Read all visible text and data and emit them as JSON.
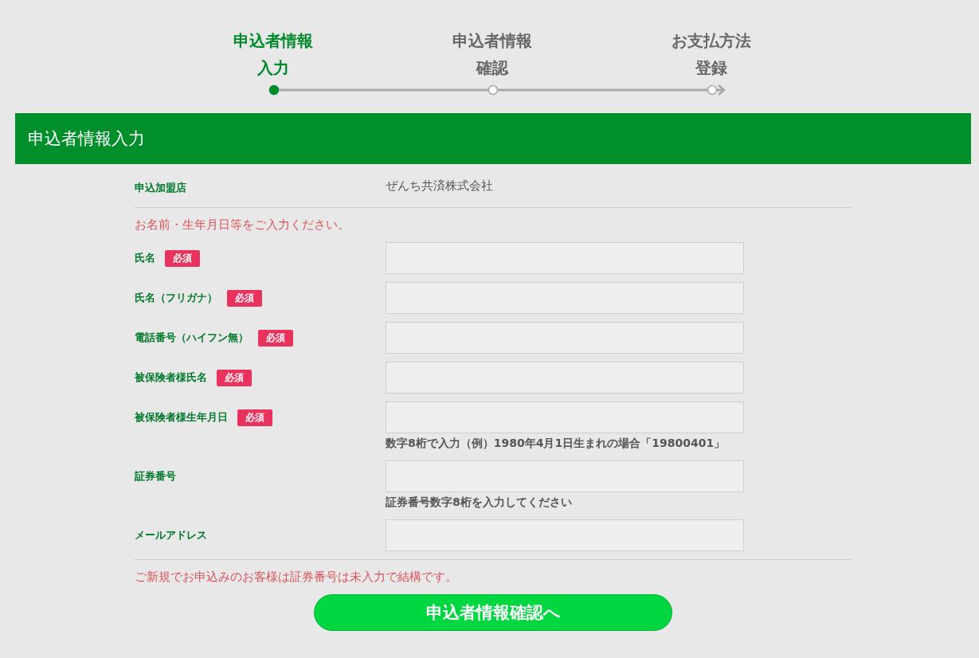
{
  "steps": [
    {
      "line1": "申込者情報",
      "line2": "入力",
      "selected": true
    },
    {
      "line1": "申込者情報",
      "line2": "確認",
      "selected": false
    },
    {
      "line1": "お支払方法",
      "line2": "登録",
      "selected": false
    }
  ],
  "section_title": "申込者情報入力",
  "shop": {
    "label": "申込加盟店",
    "value": "ぜんち共済株式会社"
  },
  "intro_notice": "お名前・生年月日等をご入力ください。",
  "fields": [
    {
      "label": "氏名",
      "badge": "必須"
    },
    {
      "label": "氏名（フリガナ）",
      "badge": "必須"
    },
    {
      "label": "電話番号（ハイフン無）",
      "badge": "必須"
    },
    {
      "label": "被保険者様氏名",
      "badge": "必須"
    },
    {
      "label": "被保険者様生年月日",
      "badge": "必須",
      "hint": "数字8桁で入力（例）1980年4月1日生まれの場合「19800401」"
    },
    {
      "label": "証券番号",
      "hint": "証券番号数字8桁を入力してください"
    },
    {
      "label": "メールアドレス"
    }
  ],
  "bottom_notice": "ご新規でお申込みのお客様は証券番号は未入力で結構です。",
  "submit_button": "申込者情報確認へ"
}
